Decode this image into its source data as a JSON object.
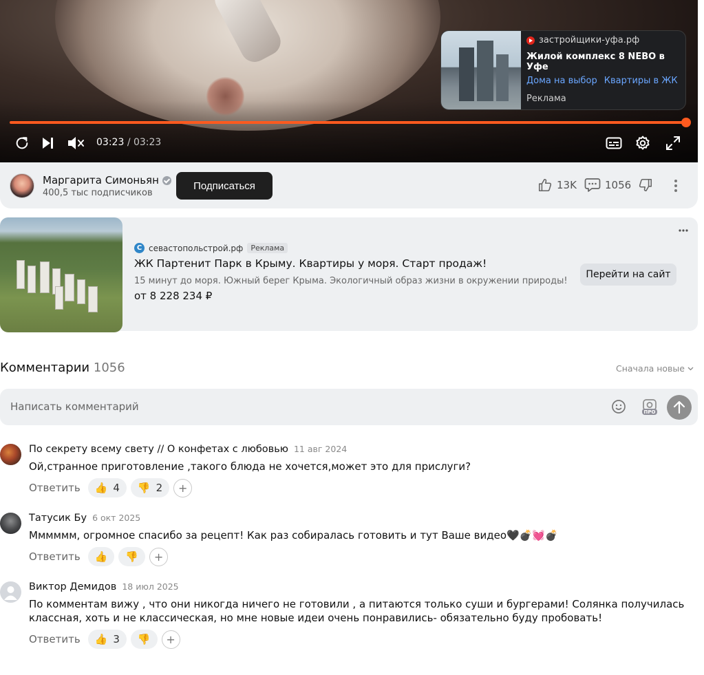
{
  "player": {
    "time_current": "03:23",
    "time_sep": "/",
    "time_total": "03:23",
    "progress": 1.0,
    "ad": {
      "source": "застройщики-уфа.рф",
      "title": "Жилой комплекс 8 NEBO в Уфе",
      "link1": "Дома на выбор",
      "link2": "Квартиры в ЖК",
      "label": "Реклама"
    },
    "accent_color": "#ff5a1f"
  },
  "channel": {
    "name": "Маргарита Симоньян",
    "subscribers": "400,5 тыс подписчиков",
    "subscribe_label": "Подписаться",
    "likes": "13K",
    "comments": "1056"
  },
  "promo": {
    "source": "севастопольстрой.рф",
    "source_logo": "С",
    "tag": "Реклама",
    "title": "ЖК Партенит Парк в Крыму. Квартиры у моря. Старт продаж!",
    "description": "15 минут до моря. Южный берег Крыма. Экологичный образ жизни в окружении природы!",
    "price": "от 8 228 234 ₽",
    "button": "Перейти на сайт"
  },
  "comments_section": {
    "heading": "Комментарии",
    "count": "1056",
    "sort_label": "Сначала новые",
    "input_placeholder": "Написать комментарий",
    "items": [
      {
        "author": "По секрету всему свету // О конфетах с любовью",
        "date": "11 авг 2024",
        "text": "Ой,странное приготовление ,такого блюда не хочется,может это для прислуги?",
        "reply": "Ответить",
        "likes": "4",
        "dislikes": "2"
      },
      {
        "author": "Татусик Бу",
        "date": "6 окт 2025",
        "text": "Мммммм, огромное спасибо за рецепт! Как раз собиралась готовить и тут Ваше видео🖤💣💓💣",
        "reply": "Ответить",
        "likes": "",
        "dislikes": ""
      },
      {
        "author": "Виктор Демидов",
        "date": "18 июл 2025",
        "text": "По комментам вижу , что они никогда ничего не готовили , а питаются только суши и бургерами! Солянка получилась классная, хоть и не классическая, но мне новые идеи очень понравились- обязательно буду пробовать!",
        "reply": "Ответить",
        "likes": "3",
        "dislikes": ""
      }
    ]
  },
  "icons": {
    "like": "👍",
    "dislike": "👎",
    "add": "+"
  }
}
